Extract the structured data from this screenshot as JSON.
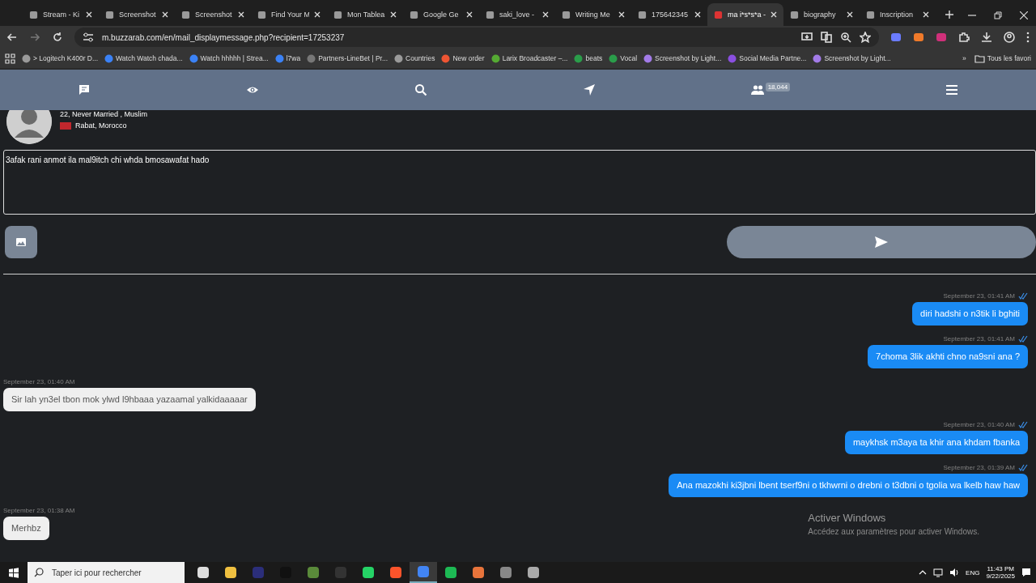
{
  "browser": {
    "tabs": [
      {
        "title": "Stream - Ki",
        "selected": false
      },
      {
        "title": "Screenshot",
        "selected": false
      },
      {
        "title": "Screenshot",
        "selected": false
      },
      {
        "title": "Find Your M",
        "selected": false
      },
      {
        "title": "Mon Tablea",
        "selected": false
      },
      {
        "title": "Google Ge",
        "selected": false
      },
      {
        "title": "saki_love -",
        "selected": false
      },
      {
        "title": "Writing Me",
        "selected": false
      },
      {
        "title": "175642345",
        "selected": false
      },
      {
        "title": "ma i*s*s*a -",
        "selected": true
      },
      {
        "title": "biography",
        "selected": false
      },
      {
        "title": "Inscription",
        "selected": false
      }
    ],
    "address": "m.buzzarab.com/en/mail_displaymessage.php?recipient=17253237",
    "bookmarks": [
      "> Logitech K400r D...",
      "Watch Watch chada...",
      "Watch hhhhh | Strea...",
      "l7wa",
      "Partners-LineBet | Pr...",
      "Countries",
      "New order",
      "Larix Broadcaster –...",
      "beats",
      "Vocal",
      "Screenshot by Light...",
      "Social Media Partne...",
      "Screenshot by Light..."
    ],
    "overflow": "»",
    "all_bookmarks": "Tous les favori"
  },
  "nav": {
    "badge": "18,044"
  },
  "profile": {
    "details": "22, Never Married , Muslim",
    "location": "Rabat, Morocco"
  },
  "composer": {
    "value": "3afak rani anmot ila mal9itch chi whda bmosawafat hado"
  },
  "messages": [
    {
      "kind": "sent",
      "time": "September 23, 01:41 AM",
      "text": "diri hadshi o n3tik li bghiti",
      "read": true
    },
    {
      "kind": "sent",
      "time": "September 23, 01:41 AM",
      "text": "7choma 3lik akhti chno na9sni ana ?",
      "read": true
    },
    {
      "kind": "received",
      "time": "September 23, 01:40 AM",
      "text": "Sir lah yn3el tbon mok ylwd l9hbaaa yazaamal yalkidaaaaar",
      "read": false
    },
    {
      "kind": "sent",
      "time": "September 23, 01:40 AM",
      "text": "maykhsk m3aya ta khir ana khdam fbanka",
      "read": true
    },
    {
      "kind": "sent",
      "time": "September 23, 01:39 AM",
      "text": "Ana mazokhi ki3jbni lbent tserf9ni o tkhwrni o drebni o t3dbni o tgolia wa lkelb haw haw",
      "read": true
    },
    {
      "kind": "received",
      "time": "September 23, 01:38 AM",
      "text": "Merhbz",
      "read": false
    }
  ],
  "windows_notice": {
    "title": "Activer Windows",
    "text": "Accédez aux paramètres pour activer Windows."
  },
  "taskbar": {
    "search_placeholder": "Taper ici pour rechercher",
    "apps": [
      {
        "selected": false
      },
      {
        "selected": false
      },
      {
        "selected": false
      },
      {
        "selected": false
      },
      {
        "selected": false
      },
      {
        "selected": false
      },
      {
        "selected": false
      },
      {
        "selected": false
      },
      {
        "selected": true
      },
      {
        "selected": false
      },
      {
        "selected": false
      },
      {
        "selected": false
      },
      {
        "selected": false
      }
    ],
    "language": "ENG",
    "time": "11:43 PM",
    "date": "9/22/2025"
  }
}
